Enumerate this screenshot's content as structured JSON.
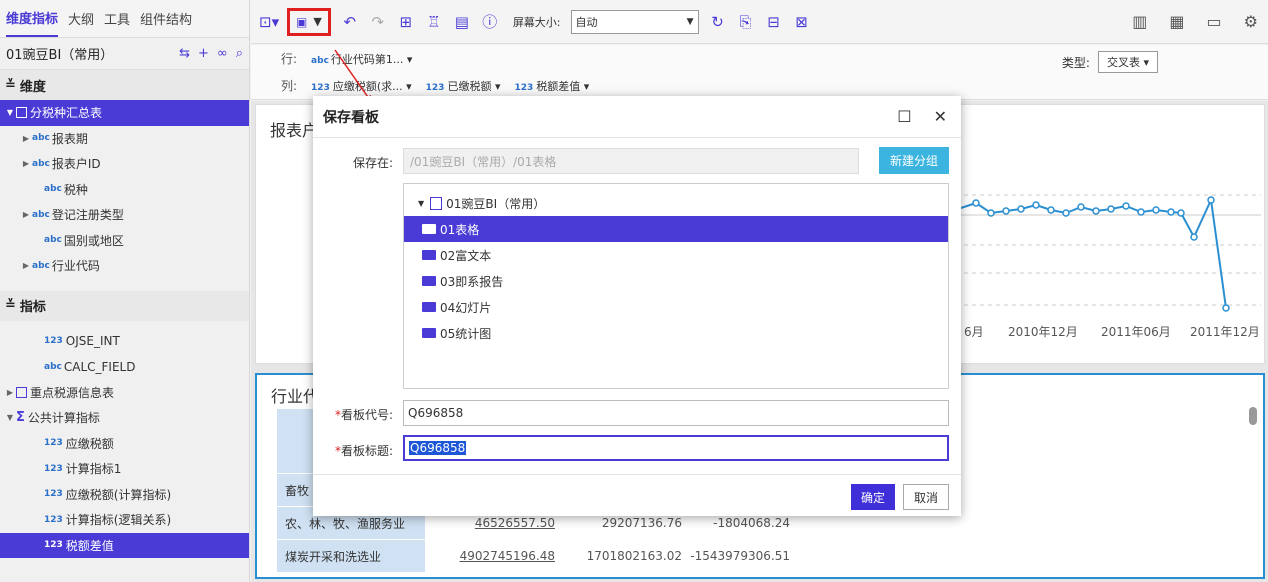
{
  "left_panel": {
    "tabs": [
      "维度指标",
      "大纲",
      "工具",
      "组件结构"
    ],
    "datasource": "01豌豆BI（常用）",
    "dimension_header": "维度",
    "dimension_items": [
      {
        "label": "分税种汇总表",
        "kind": "table",
        "expand": "▼"
      },
      {
        "label": "报表期",
        "kind": "abc",
        "expand": "▶"
      },
      {
        "label": "报表户ID",
        "kind": "abc",
        "expand": "▶"
      },
      {
        "label": "税种",
        "kind": "abc",
        "expand": ""
      },
      {
        "label": "登记注册类型",
        "kind": "abc",
        "expand": "▶"
      },
      {
        "label": "国别或地区",
        "kind": "abc",
        "expand": ""
      },
      {
        "label": "行业代码",
        "kind": "abc",
        "expand": "▶"
      }
    ],
    "metric_header": "指标",
    "metric_items": [
      {
        "label": "OJSE_INT",
        "kind": "123",
        "expand": ""
      },
      {
        "label": "CALC_FIELD",
        "kind": "abc",
        "expand": ""
      },
      {
        "label": "重点税源信息表",
        "kind": "table",
        "expand": "▶"
      },
      {
        "label": "公共计算指标",
        "kind": "sigma",
        "expand": "▼"
      },
      {
        "label": "应缴税额",
        "kind": "123",
        "expand": ""
      },
      {
        "label": "计算指标1",
        "kind": "123",
        "expand": ""
      },
      {
        "label": "应缴税额(计算指标)",
        "kind": "123",
        "expand": ""
      },
      {
        "label": "计算指标(逻辑关系)",
        "kind": "123",
        "expand": ""
      },
      {
        "label": "税额差值",
        "kind": "123",
        "expand": ""
      }
    ]
  },
  "toolbar": {
    "screen_size_label": "屏幕大小:",
    "screen_size_value": "自动"
  },
  "rowcol": {
    "row_label": "行:",
    "row_field": "行业代码第1...",
    "col_label": "列:",
    "col_fields": [
      "应缴税额(求...",
      "已缴税额",
      "税额差值"
    ],
    "type_label": "类型:",
    "type_value": "交叉表"
  },
  "chart_panel": {
    "title": "报表户",
    "xticks": [
      "6月",
      "2010年12月",
      "2011年06月",
      "2011年12月"
    ]
  },
  "table_panel": {
    "title": "行业代",
    "rows": [
      {
        "name": "畜牧",
        "a": "",
        "b": "",
        "c": ""
      },
      {
        "name": "农、林、牧、渔服务业",
        "a": "46526557.50",
        "b": "29207136.76",
        "c": "-1804068.24"
      },
      {
        "name": "煤炭开采和洗选业",
        "a": "4902745196.48",
        "b": "1701802163.02",
        "c": "-1543979306.51"
      }
    ]
  },
  "dialog": {
    "title": "保存看板",
    "save_in_label": "保存在:",
    "save_in_value": "/01豌豆BI（常用）/01表格",
    "new_group": "新建分组",
    "root": "01豌豆BI（常用）",
    "folders": [
      "01表格",
      "02富文本",
      "03即系报告",
      "04幻灯片",
      "05统计图"
    ],
    "code_label": "看板代号:",
    "code_value": "Q696858",
    "title_label": "看板标题:",
    "title_value": "Q696858",
    "ok": "确定",
    "cancel": "取消"
  }
}
